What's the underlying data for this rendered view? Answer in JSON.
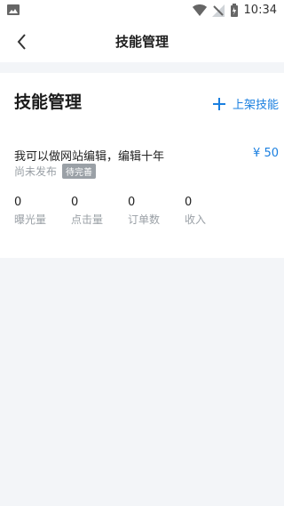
{
  "status_bar": {
    "time": "10:34"
  },
  "navbar": {
    "title": "技能管理"
  },
  "card": {
    "heading": "技能管理",
    "add_label": "上架技能",
    "item": {
      "title": "我可以做网站编辑，编辑十年",
      "price": "¥ 50",
      "status": "尚未发布",
      "badge": "待完善"
    },
    "stats": [
      {
        "value": "0",
        "label": "曝光量"
      },
      {
        "value": "0",
        "label": "点击量"
      },
      {
        "value": "0",
        "label": "订单数"
      },
      {
        "value": "0",
        "label": "收入"
      }
    ]
  },
  "colors": {
    "accent": "#1a7fe0",
    "muted": "#9aa0a6",
    "background": "#f3f5f8"
  },
  "icons": {
    "left_status_icon": "image-icon",
    "wifi": "wifi-icon",
    "signal": "signal-icon",
    "battery": "battery-icon",
    "back": "back-chevron-icon"
  }
}
